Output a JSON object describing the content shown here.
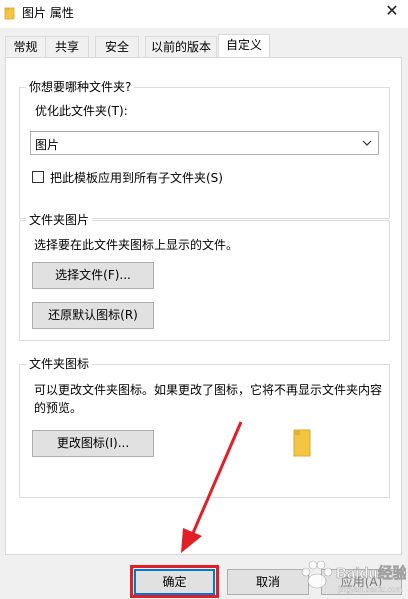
{
  "window": {
    "title": "图片 属性",
    "close_glyph": "✕"
  },
  "tabs": [
    {
      "label": "常规"
    },
    {
      "label": "共享"
    },
    {
      "label": "安全"
    },
    {
      "label": "以前的版本"
    },
    {
      "label": "自定义",
      "active": true
    }
  ],
  "optimize_group": {
    "title": "你想要哪种文件夹?",
    "optimize_label": "优化此文件夹(T):",
    "optimize_value": "图片",
    "apply_checkbox_label": "把此模板应用到所有子文件夹(S)",
    "apply_checked": false
  },
  "picture_group": {
    "title": "文件夹图片",
    "description": "选择要在此文件夹图标上显示的文件。",
    "choose_file_button": "选择文件(F)...",
    "restore_default_button": "还原默认图标(R)"
  },
  "icon_group": {
    "title": "文件夹图标",
    "description_line1": "可以更改文件夹图标。如果更改了图标，它将不再显示文件夹内容",
    "description_line2": "的预览。",
    "change_icon_button": "更改图标(I)..."
  },
  "footer": {
    "ok_button": "确定",
    "cancel_button": "取消",
    "apply_button": "应用(A)"
  },
  "watermark": {
    "text": "Baidu经验",
    "subtext": "jingyan.baidu.com"
  },
  "colors": {
    "annotation_red": "#e21f26",
    "focus_blue": "#0078d7",
    "folder_yellow": "#f4c542"
  }
}
